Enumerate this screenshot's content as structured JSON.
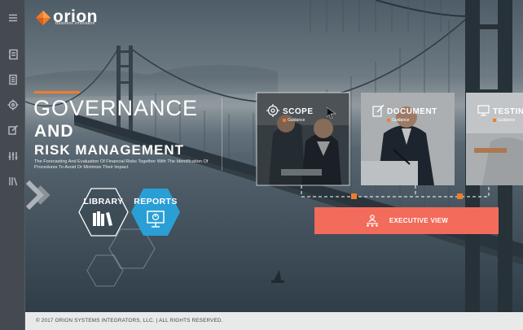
{
  "brand": {
    "name": "orion",
    "tagline": "Business Innovation",
    "accent": "#f07c2c"
  },
  "sidebar": {
    "items": [
      {
        "icon": "menu-icon"
      },
      {
        "icon": "notebook-icon"
      },
      {
        "icon": "document-list-icon"
      },
      {
        "icon": "target-icon"
      },
      {
        "icon": "edit-icon"
      },
      {
        "icon": "sliders-icon"
      },
      {
        "icon": "library-icon"
      }
    ]
  },
  "hero": {
    "line1": "GOVERNANCE",
    "line2": "AND",
    "line3": "RISK MANAGEMENT",
    "description": "The Forecasting And Evaluation Of Financial Risks Together With The Identification Of Procedures To Avoid Or Minimize Their Impact."
  },
  "hex_nav": {
    "library": "LIBRARY",
    "reports": "REPORTS",
    "reports_color": "#2a9fd6"
  },
  "cards": [
    {
      "title": "SCOPE",
      "sub": "Guidance",
      "icon": "target-icon"
    },
    {
      "title": "DOCUMENT",
      "sub": "Guidance",
      "icon": "edit-document-icon"
    },
    {
      "title": "TESTING",
      "sub": "Guidance",
      "icon": "monitor-icon"
    }
  ],
  "executive": {
    "label": "EXECUTIVE VIEW",
    "color": "#f26b5b"
  },
  "footer": {
    "copyright": "© 2017 ORION SYSTEMS INTEGRATORS, LLC. | ALL RIGHTS RESERVED."
  }
}
